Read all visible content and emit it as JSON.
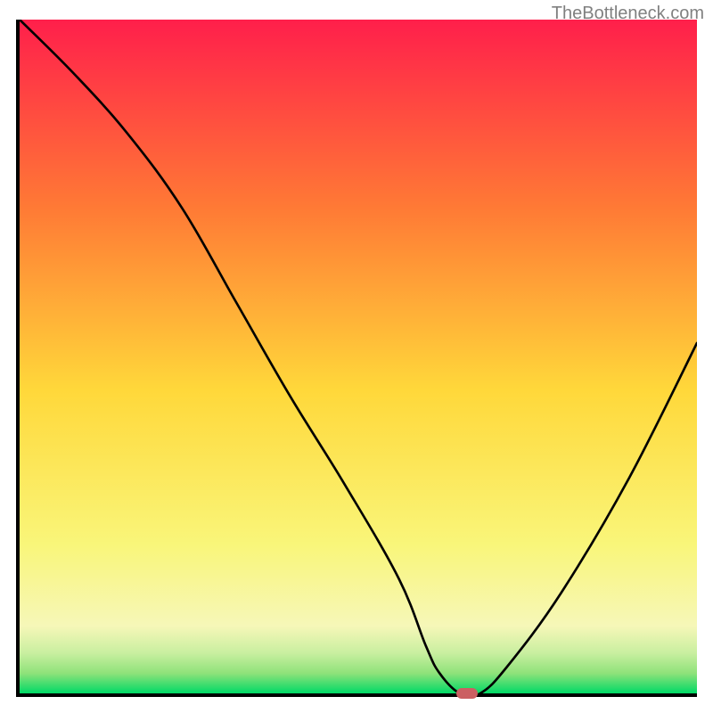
{
  "watermark": "TheBottleneck.com",
  "chart_data": {
    "type": "line",
    "title": "",
    "xlabel": "",
    "ylabel": "",
    "xlim": [
      0,
      100
    ],
    "ylim": [
      0,
      100
    ],
    "grid": false,
    "series": [
      {
        "name": "curve",
        "x": [
          0,
          8,
          16,
          24,
          32,
          40,
          48,
          56,
          60,
          62,
          65,
          68,
          72,
          80,
          90,
          100
        ],
        "values": [
          100,
          92,
          83,
          72,
          58,
          44,
          31,
          17,
          7,
          3,
          0,
          0,
          4,
          15,
          32,
          52
        ]
      }
    ],
    "marker": {
      "x": 66,
      "y": 0,
      "color": "#cb5f62"
    },
    "gradient": {
      "top_color": "#ff1f4b",
      "mid_upper_color": "#ff7a35",
      "mid_color": "#ffd83a",
      "lower_yellow": "#f9f67a",
      "green_band_top": "#8fe27a",
      "green_band_bottom": "#00d966"
    }
  }
}
